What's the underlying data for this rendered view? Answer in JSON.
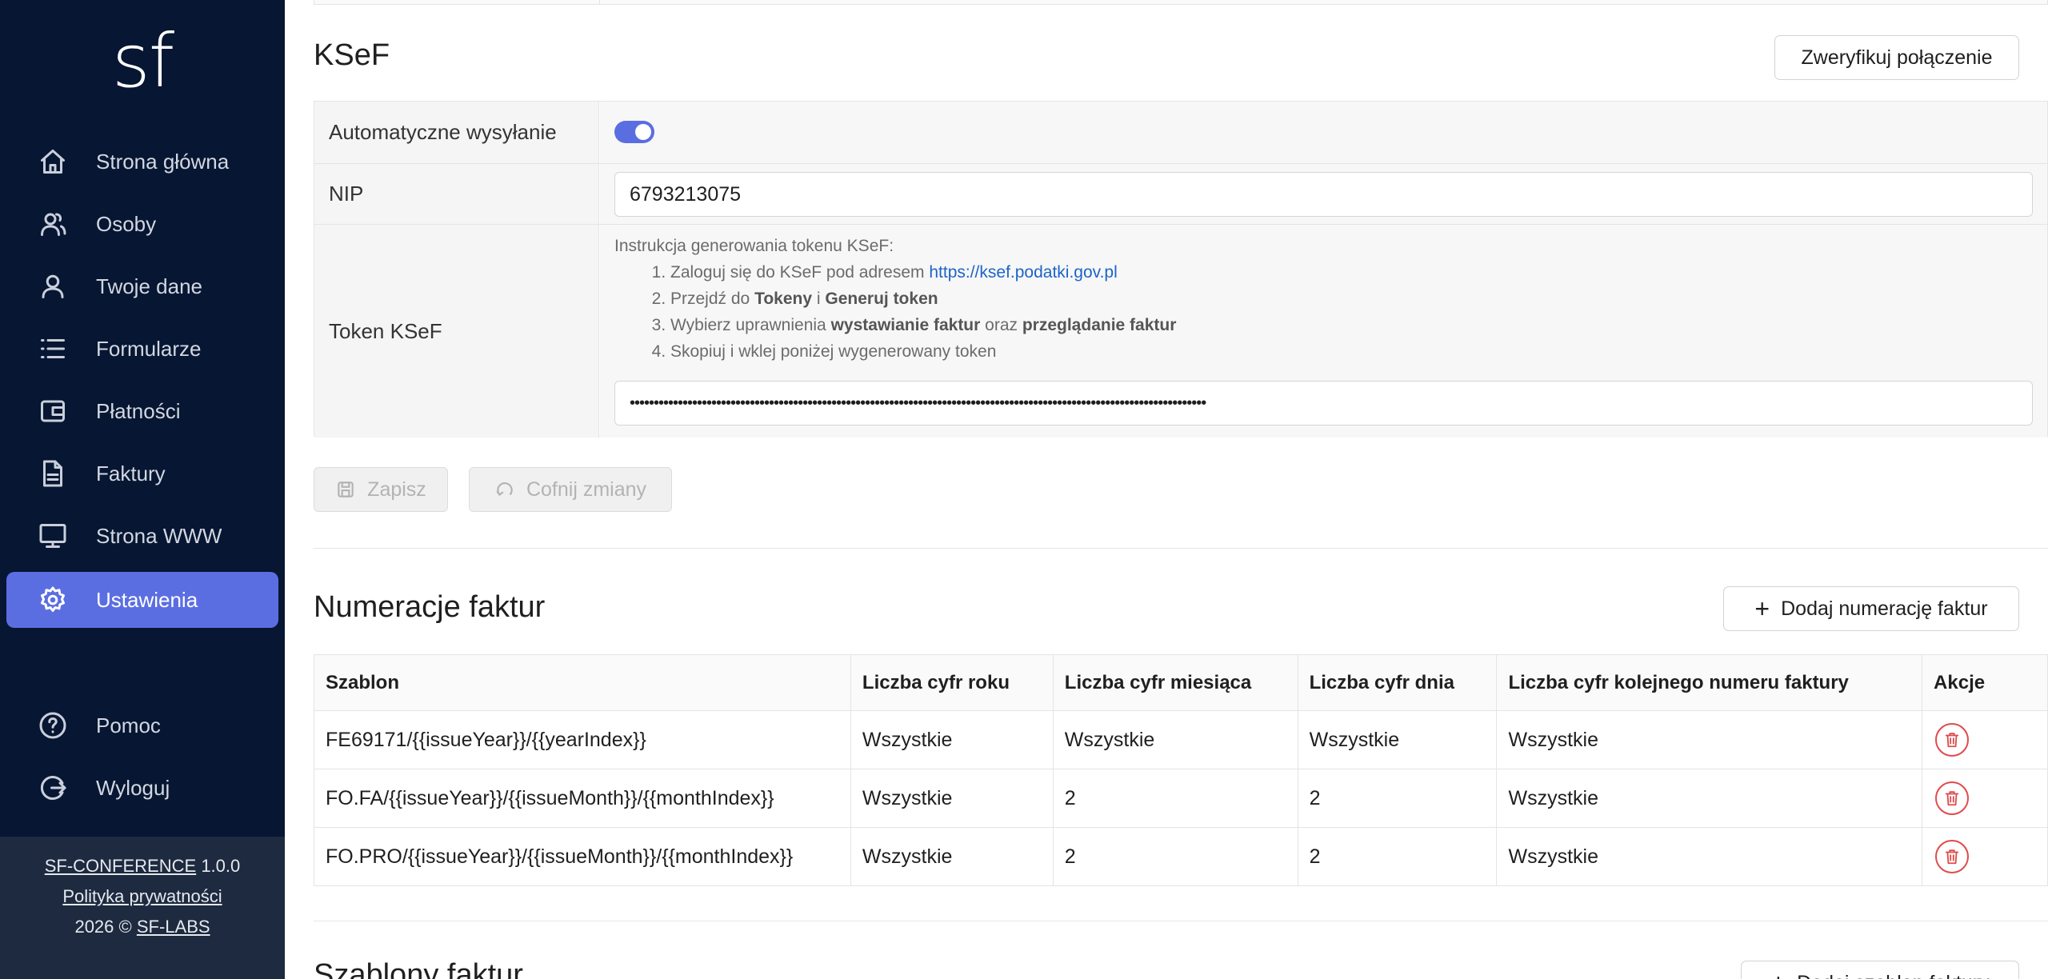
{
  "app": {
    "logo_text": "sf"
  },
  "sidebar": {
    "items": [
      {
        "label": "Strona główna",
        "icon": "home-icon"
      },
      {
        "label": "Osoby",
        "icon": "users-icon"
      },
      {
        "label": "Twoje dane",
        "icon": "user-icon"
      },
      {
        "label": "Formularze",
        "icon": "list-icon"
      },
      {
        "label": "Płatności",
        "icon": "wallet-icon"
      },
      {
        "label": "Faktury",
        "icon": "document-icon"
      },
      {
        "label": "Strona WWW",
        "icon": "monitor-icon"
      },
      {
        "label": "Ustawienia",
        "icon": "gear-icon",
        "active": true
      },
      {
        "label": "Pomoc",
        "icon": "help-icon"
      },
      {
        "label": "Wyloguj",
        "icon": "logout-icon"
      }
    ],
    "footer": {
      "app_name": "SF-CONFERENCE",
      "version": "1.0.0",
      "privacy": "Polityka prywatności",
      "copyright": "2026 ©",
      "company": "SF-LABS"
    }
  },
  "ksef": {
    "title": "KSeF",
    "verify_button": "Zweryfikuj połączenie",
    "auto_send_label": "Automatyczne wysyłanie",
    "auto_send_enabled": true,
    "nip_label": "NIP",
    "nip_value": "6793213075",
    "token_label": "Token KSeF",
    "instructions_title": "Instrukcja generowania tokenu KSeF:",
    "step1_text": "Zaloguj się do KSeF pod adresem ",
    "step1_link": "https://ksef.podatki.gov.pl",
    "step2_a": "Przejdź do ",
    "step2_b": "Tokeny",
    "step2_c": " i ",
    "step2_d": "Generuj token",
    "step3_a": "Wybierz uprawnienia ",
    "step3_b": "wystawianie faktur",
    "step3_c": " oraz ",
    "step3_d": "przeglądanie faktur",
    "step4": "Skopiuj i wklej poniżej wygenerowany token",
    "token_value": "••••••••••••••••••••••••••••••••••••••••••••••••••••••••••••••••••••••••••••••••••••••••••••••••••••••••••••••••••••••••",
    "save_button": "Zapisz",
    "revert_button": "Cofnij zmiany"
  },
  "numbering": {
    "title": "Numeracje faktur",
    "add_button": "Dodaj numerację faktur",
    "columns": [
      "Szablon",
      "Liczba cyfr roku",
      "Liczba cyfr miesiąca",
      "Liczba cyfr dnia",
      "Liczba cyfr kolejnego numeru faktury",
      "Akcje"
    ],
    "rows": [
      [
        "FE69171/{{issueYear}}/{{yearIndex}}",
        "Wszystkie",
        "Wszystkie",
        "Wszystkie",
        "Wszystkie"
      ],
      [
        "FO.FA/{{issueYear}}/{{issueMonth}}/{{monthIndex}}",
        "Wszystkie",
        "2",
        "2",
        "Wszystkie"
      ],
      [
        "FO.PRO/{{issueYear}}/{{issueMonth}}/{{monthIndex}}",
        "Wszystkie",
        "2",
        "2",
        "Wszystkie"
      ]
    ]
  },
  "templates": {
    "title": "Szablony faktur",
    "add_button": "Dodaj szablon faktury"
  }
}
